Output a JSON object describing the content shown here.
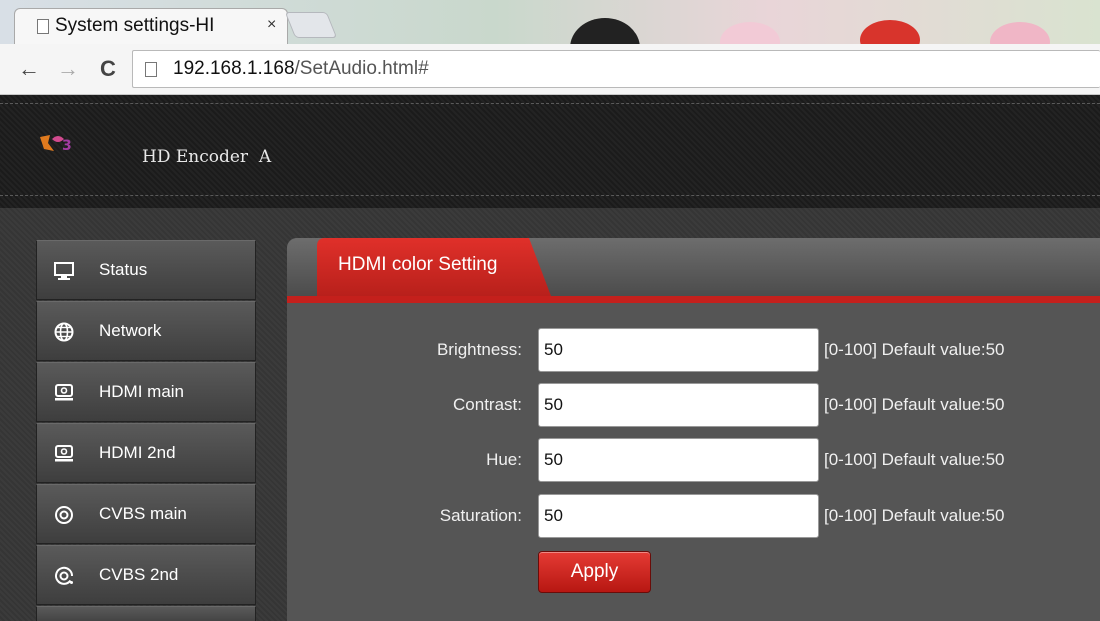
{
  "browser": {
    "tab_title": "System settings-HI",
    "tab_close": "×",
    "url_host": "192.168.1.168",
    "url_path": "/SetAudio.html#",
    "back": "←",
    "forward": "→",
    "reload": "C"
  },
  "header": {
    "title": "HD Encoder  A"
  },
  "sidebar": {
    "items": [
      {
        "label": "Status",
        "icon": "monitor-icon"
      },
      {
        "label": "Network",
        "icon": "globe-icon"
      },
      {
        "label": "HDMI main",
        "icon": "hdmi-icon"
      },
      {
        "label": "HDMI 2nd",
        "icon": "hdmi-icon"
      },
      {
        "label": "CVBS main",
        "icon": "target-icon"
      },
      {
        "label": "CVBS 2nd",
        "icon": "target-icon"
      }
    ]
  },
  "panel": {
    "tab_label": "HDMI color Setting",
    "fields": [
      {
        "label": "Brightness:",
        "value": "50",
        "hint": "[0-100] Default value:50"
      },
      {
        "label": "Contrast:",
        "value": "50",
        "hint": "[0-100] Default value:50"
      },
      {
        "label": "Hue:",
        "value": "50",
        "hint": "[0-100] Default value:50"
      },
      {
        "label": "Saturation:",
        "value": "50",
        "hint": "[0-100] Default value:50"
      }
    ],
    "apply_label": "Apply"
  },
  "colors": {
    "accent_red": "#c4201c",
    "header_bg": "#1f1f1f",
    "body_bg": "#383838"
  }
}
